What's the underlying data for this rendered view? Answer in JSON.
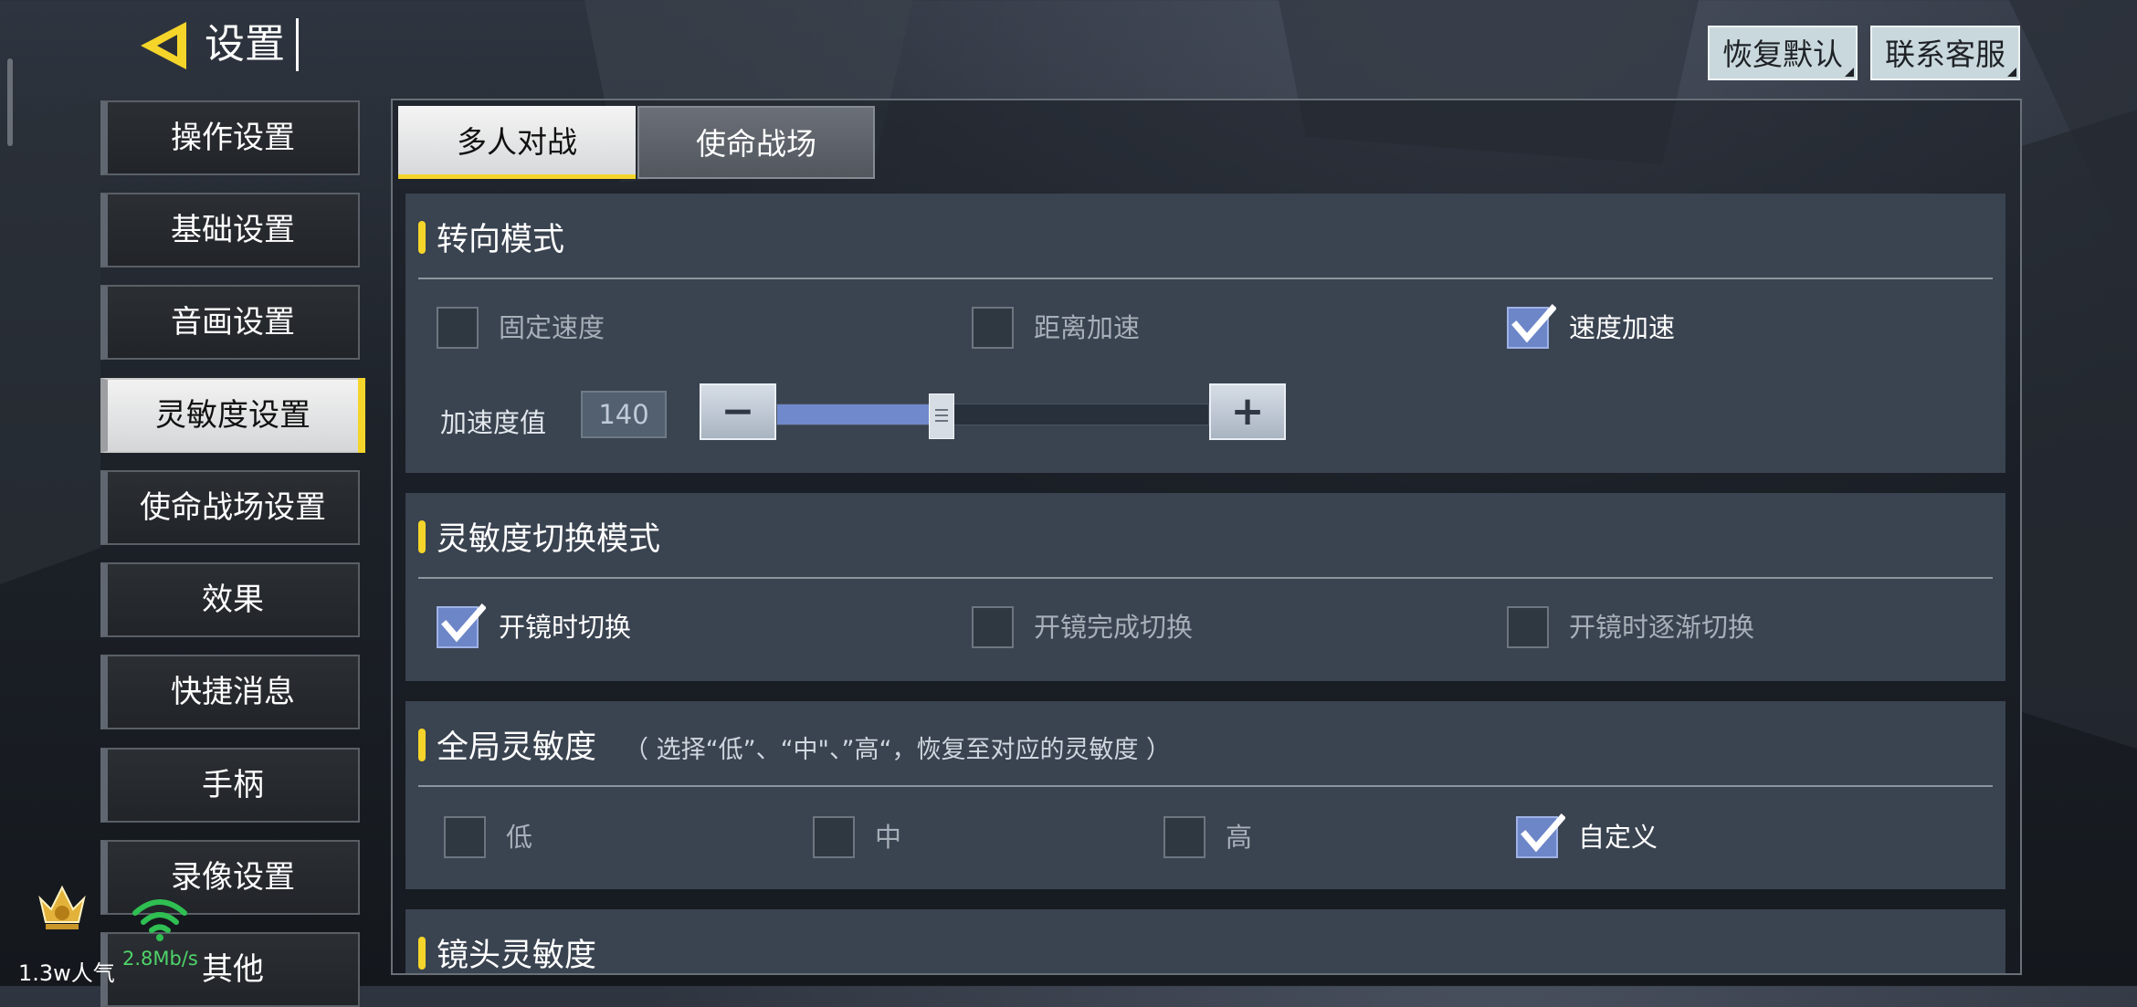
{
  "header": {
    "title": "设置",
    "restore_default": "恢复默认",
    "contact_support": "联系客服"
  },
  "sidebar": {
    "items": [
      {
        "label": "操作设置",
        "active": false
      },
      {
        "label": "基础设置",
        "active": false
      },
      {
        "label": "音画设置",
        "active": false
      },
      {
        "label": "灵敏度设置",
        "active": true
      },
      {
        "label": "使命战场设置",
        "active": false
      },
      {
        "label": "效果",
        "active": false
      },
      {
        "label": "快捷消息",
        "active": false
      },
      {
        "label": "手柄",
        "active": false
      },
      {
        "label": "录像设置",
        "active": false
      },
      {
        "label": "其他",
        "active": false
      }
    ]
  },
  "tabs": [
    {
      "label": "多人对战",
      "active": true
    },
    {
      "label": "使命战场",
      "active": false
    }
  ],
  "turn_mode": {
    "title": "转向模式",
    "options": [
      {
        "label": "固定速度",
        "checked": false
      },
      {
        "label": "距离加速",
        "checked": false
      },
      {
        "label": "速度加速",
        "checked": true
      }
    ],
    "accel_label": "加速度值",
    "accel_value": "140",
    "accel_fraction": 0.38
  },
  "switch_mode": {
    "title": "灵敏度切换模式",
    "options": [
      {
        "label": "开镜时切换",
        "checked": true
      },
      {
        "label": "开镜完成切换",
        "checked": false
      },
      {
        "label": "开镜时逐渐切换",
        "checked": false
      }
    ]
  },
  "global_sensitivity": {
    "title": "全局灵敏度",
    "note": "（ 选择“低”、“中\"、”高“，恢复至对应的灵敏度 ）",
    "options": [
      {
        "label": "低",
        "checked": false
      },
      {
        "label": "中",
        "checked": false
      },
      {
        "label": "高",
        "checked": false
      },
      {
        "label": "自定义",
        "checked": true
      }
    ]
  },
  "camera_sensitivity": {
    "title": "镜头灵敏度"
  },
  "overlay": {
    "popularity": "1.3w人气",
    "speed": "2.8Mb/s"
  },
  "colors": {
    "accent": "#f5d52a",
    "checkbox_checked": "#6d86c8",
    "section_bg": "#3a4350",
    "network_green": "#4fd36a"
  }
}
